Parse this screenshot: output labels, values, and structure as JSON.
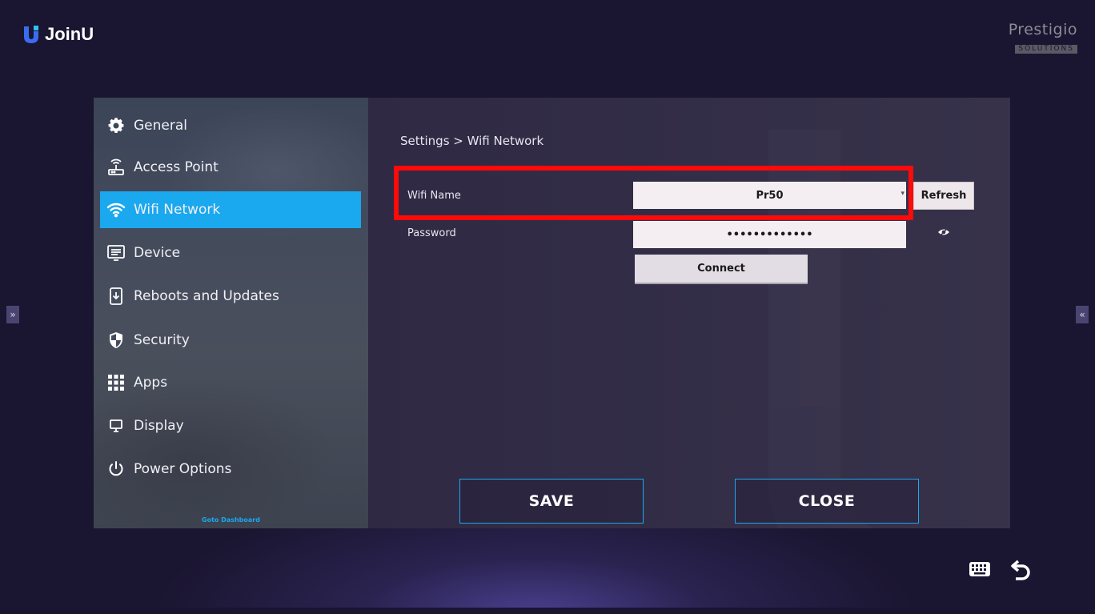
{
  "app": {
    "name": "JoinU"
  },
  "brand": {
    "name": "Prestigio",
    "sub": "SOLUTIONS"
  },
  "sidebar": {
    "items": [
      {
        "label": "General",
        "icon": "gear-icon"
      },
      {
        "label": "Access Point",
        "icon": "router-icon"
      },
      {
        "label": "Wifi Network",
        "icon": "wifi-icon",
        "active": true
      },
      {
        "label": "Device",
        "icon": "monitor-icon"
      },
      {
        "label": "Reboots and Updates",
        "icon": "download-icon"
      },
      {
        "label": "Security",
        "icon": "shield-icon"
      },
      {
        "label": "Apps",
        "icon": "grid-icon"
      },
      {
        "label": "Display",
        "icon": "display-icon"
      },
      {
        "label": "Power Options",
        "icon": "power-icon"
      }
    ],
    "goto_dashboard": "Goto Dashboard"
  },
  "main": {
    "breadcrumb": "Settings > Wifi Network",
    "wifi_name_label": "Wifi Name",
    "wifi_name_value": "Pr50",
    "password_label": "Password",
    "password_value": "•••••••••••••",
    "refresh_label": "Refresh",
    "connect_label": "Connect",
    "save_label": "SAVE",
    "close_label": "CLOSE"
  },
  "edge": {
    "left_arrow": "»",
    "right_arrow": "«"
  },
  "colors": {
    "accent": "#1aa8ef",
    "highlight": "#ff0a0a",
    "background": "#1a1530"
  }
}
